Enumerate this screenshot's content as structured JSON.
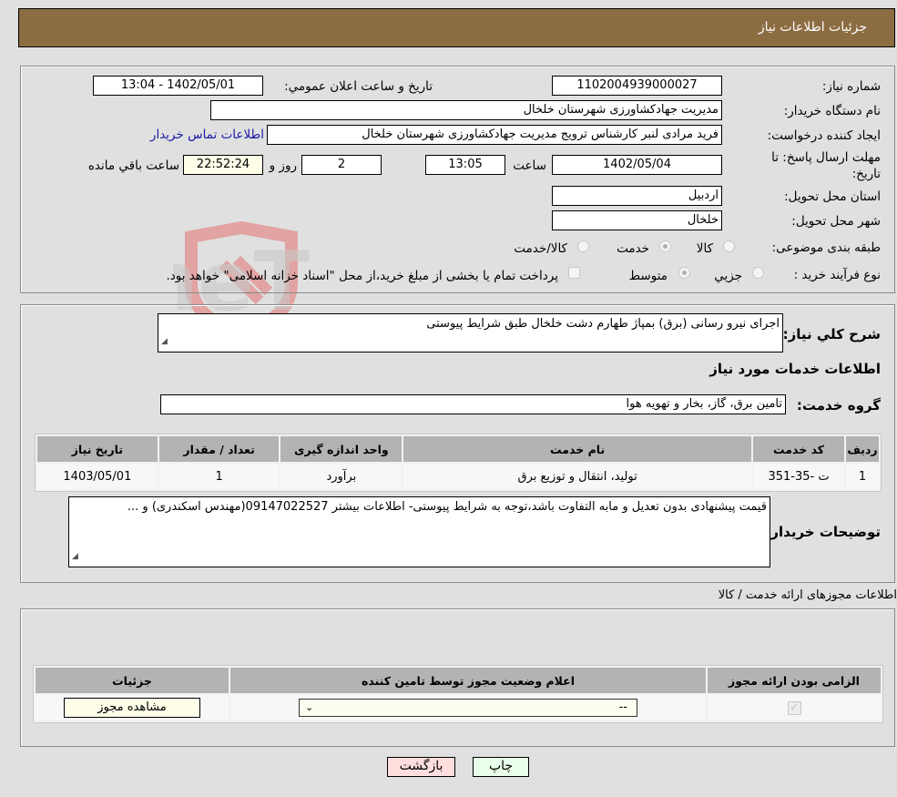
{
  "header": {
    "title": "جزئیات اطلاعات نیاز"
  },
  "form": {
    "need_number": {
      "label": "شماره نیاز:",
      "value": "1102004939000027"
    },
    "announce_datetime": {
      "label": "تاريخ و ساعت اعلان عمومي:",
      "value": "1402/05/01 - 13:04"
    },
    "buyer_org": {
      "label": "نام دستگاه خريدار:",
      "value": "مديريت جهادكشاورزی شهرستان خلخال"
    },
    "requester": {
      "label": "ايجاد كننده درخواست:",
      "value": "فريد مرادی لنبر كارشناس ترويج مديريت جهادكشاورزی شهرستان خلخال"
    },
    "buyer_contact_link": "اطلاعات تماس خريدار",
    "deadline": {
      "label_line1": "مهلت ارسال پاسخ: تا",
      "label_line2": "تاريخ:",
      "date": "1402/05/04",
      "time_label": "ساعت",
      "time": "13:05",
      "days": "2",
      "days_label": "روز و",
      "remaining": "22:52:24",
      "remaining_label": "ساعت باقي مانده"
    },
    "province": {
      "label": "استان محل تحويل:",
      "value": "اردبيل"
    },
    "city": {
      "label": "شهر محل تحويل:",
      "value": "خلخال"
    },
    "category": {
      "label": "طبقه بندی موضوعی:",
      "options": [
        "كالا",
        "خدمت",
        "كالا/خدمت"
      ],
      "selected": "خدمت"
    },
    "process": {
      "label": "نوع فرآيند خريد :",
      "options": [
        "جزيي",
        "متوسط"
      ],
      "selected": "متوسط",
      "treasury_note": "پرداخت تمام يا بخشی از مبلغ خريد،از محل \"اسناد خزانه اسلامی\" خواهد بود."
    }
  },
  "summary": {
    "label": "شرح كلي نياز:",
    "value": "اجرای نيرو رسانی (برق) بمپاژ طهارم دشت خلخال طبق شرايط پيوستی"
  },
  "services_title": "اطلاعات خدمات مورد نياز",
  "service_group": {
    "label": "گروه خدمت:",
    "value": "تامين برق، گاز، بخار و تهويه هوا"
  },
  "services_table": {
    "columns": [
      "رديف",
      "كد خدمت",
      "نام خدمت",
      "واحد اندازه گيری",
      "تعداد / مقدار",
      "تاريخ نياز"
    ],
    "rows": [
      [
        "1",
        "ت -35-351",
        "توليد، انتقال و توزيع برق",
        "برآورد",
        "1",
        "1403/05/01"
      ]
    ]
  },
  "buyer_notes": {
    "label": "توضيحات خريدار:",
    "value": "قيمت پيشنهادی بدون تعديل و مابه التفاوت باشد،توجه به شرايط پيوستی- اطلاعات بيشتر 09147022527(مهندس اسكندری) و ..."
  },
  "permits": {
    "title": "اطلاعات مجوزهای ارائه خدمت / كالا",
    "columns": [
      "الزامی بودن ارائه مجوز",
      "اعلام وضعيت مجوز توسط تامين كننده",
      "جزئيات"
    ],
    "row": {
      "required": true,
      "status_selected": "--",
      "details_button": "مشاهده مجوز"
    }
  },
  "buttons": {
    "print": "چاپ",
    "back": "بازگشت"
  },
  "colors": {
    "header_bg": "#8c6d42",
    "link": "#1a1aa6",
    "print_bg": "#eaffea",
    "back_bg": "#ffdede"
  }
}
